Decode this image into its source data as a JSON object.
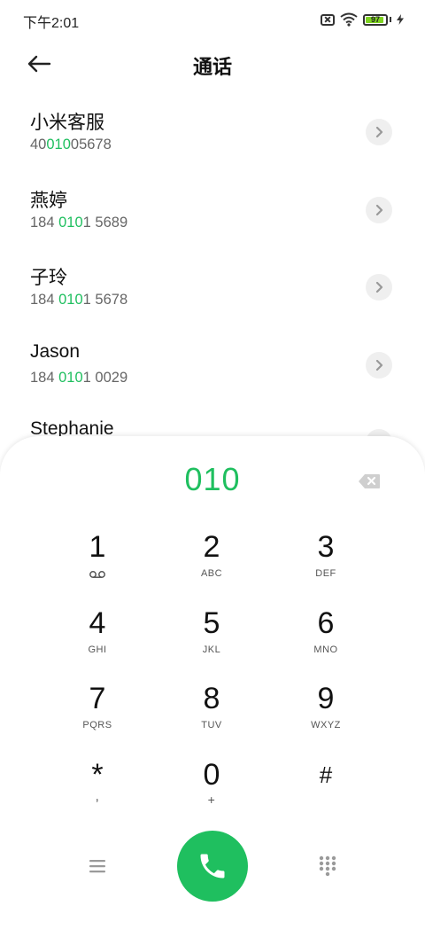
{
  "status_bar": {
    "time": "下午2:01",
    "battery_level": "97"
  },
  "header": {
    "title": "通话"
  },
  "contacts": [
    {
      "name": "小米客服",
      "number_pre": "40",
      "number_match": "010",
      "number_post": "05678"
    },
    {
      "name": "燕婷",
      "number_pre": "184 ",
      "number_match": "010",
      "number_post": "1 5689"
    },
    {
      "name": "子玲",
      "number_pre": "184 ",
      "number_match": "010",
      "number_post": "1 5678"
    },
    {
      "name": "Jason",
      "number_pre": "184 ",
      "number_match": "010",
      "number_post": "1 0029"
    },
    {
      "name": "Stephanie",
      "number_pre": "",
      "number_match": "",
      "number_post": ""
    }
  ],
  "dialpad": {
    "input_value": "010",
    "keys": [
      {
        "digit": "1",
        "letters": ""
      },
      {
        "digit": "2",
        "letters": "ABC"
      },
      {
        "digit": "3",
        "letters": "DEF"
      },
      {
        "digit": "4",
        "letters": "GHI"
      },
      {
        "digit": "5",
        "letters": "JKL"
      },
      {
        "digit": "6",
        "letters": "MNO"
      },
      {
        "digit": "7",
        "letters": "PQRS"
      },
      {
        "digit": "8",
        "letters": "TUV"
      },
      {
        "digit": "9",
        "letters": "WXYZ"
      },
      {
        "digit": "*",
        "letters": ","
      },
      {
        "digit": "0",
        "letters": "+"
      },
      {
        "digit": "#",
        "letters": ""
      }
    ]
  },
  "icons": {
    "back": "arrow-left-icon",
    "detail": "chevron-right-icon",
    "backspace": "backspace-icon",
    "voicemail": "voicemail-icon",
    "menu": "menu-icon",
    "call": "phone-icon",
    "keypad": "dialpad-icon"
  },
  "colors": {
    "accent": "#1fbf5f",
    "battery": "#7ed321"
  }
}
